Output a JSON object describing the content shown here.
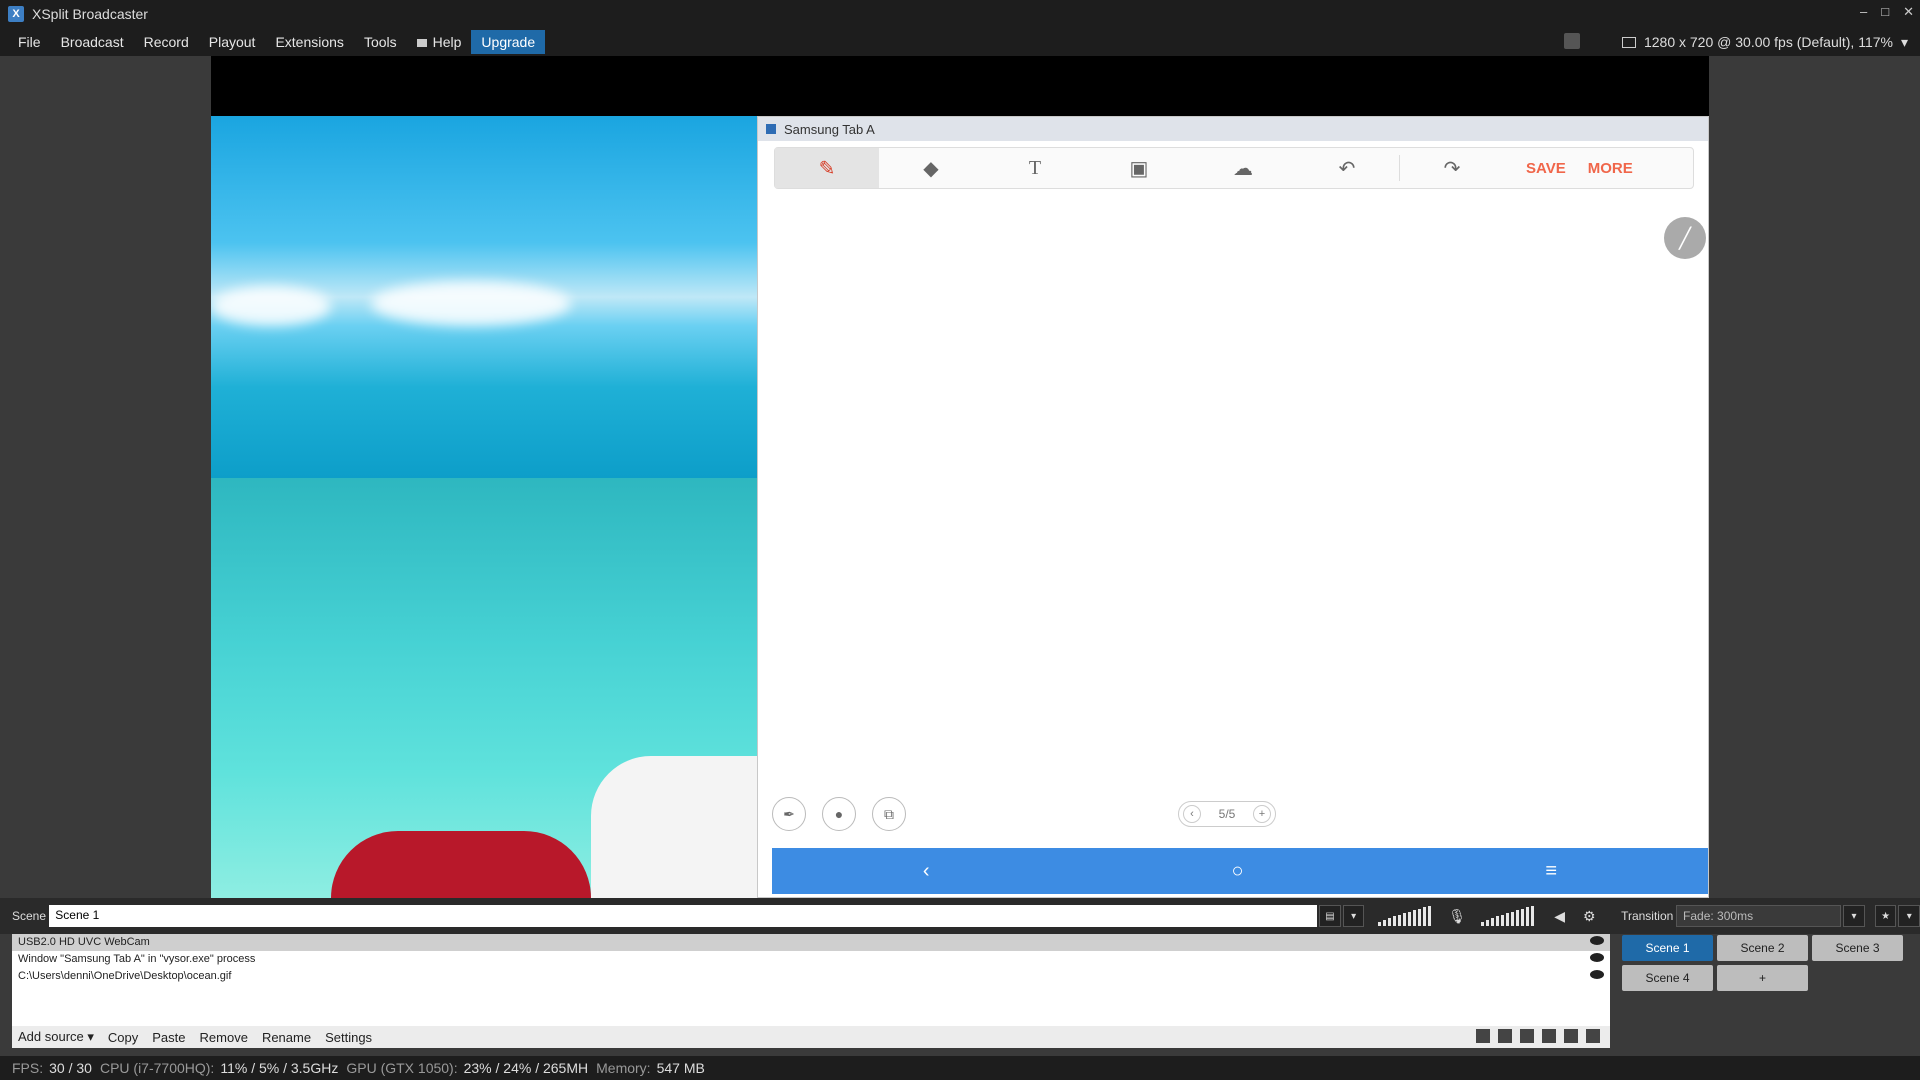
{
  "window": {
    "title": "XSplit Broadcaster",
    "controls": [
      "–",
      "□",
      "✕"
    ]
  },
  "menu": {
    "items": [
      "File",
      "Broadcast",
      "Record",
      "Playout",
      "Extensions",
      "Tools",
      "Help",
      "Upgrade"
    ],
    "resolution": "1280 x 720 @ 30.00 fps (Default), 117%"
  },
  "samsung": {
    "title": "Samsung Tab A",
    "save_label": "SAVE",
    "more_label": "MORE",
    "pager": "5/5"
  },
  "scene": {
    "label": "Scene",
    "name": "Scene 1",
    "transition_label": "Transition",
    "transition_value": "Fade: 300ms"
  },
  "sources": [
    {
      "label": "USB2.0 HD UVC WebCam",
      "selected": true
    },
    {
      "label": "Window \"Samsung Tab A\" in \"vysor.exe\" process",
      "selected": false
    },
    {
      "label": "C:\\Users\\denni\\OneDrive\\Desktop\\ocean.gif",
      "selected": false
    }
  ],
  "source_actions": [
    "Add source ▾",
    "Copy",
    "Paste",
    "Remove",
    "Rename",
    "Settings"
  ],
  "scenes": [
    "Scene 1",
    "Scene 2",
    "Scene 3",
    "Scene 4",
    "+"
  ],
  "status": {
    "fps_label": "FPS:",
    "fps": "30 / 30",
    "cpu_label": "CPU (i7-7700HQ):",
    "cpu": "11% / 5% / 3.5GHz",
    "gpu_label": "GPU (GTX 1050):",
    "gpu": "23% / 24% / 265MH",
    "mem_label": "Memory:",
    "mem": "547 MB"
  },
  "colors": {
    "accent": "#1f6aa8",
    "nav_blue": "#3d8ce3",
    "save_red": "#f0664a"
  }
}
